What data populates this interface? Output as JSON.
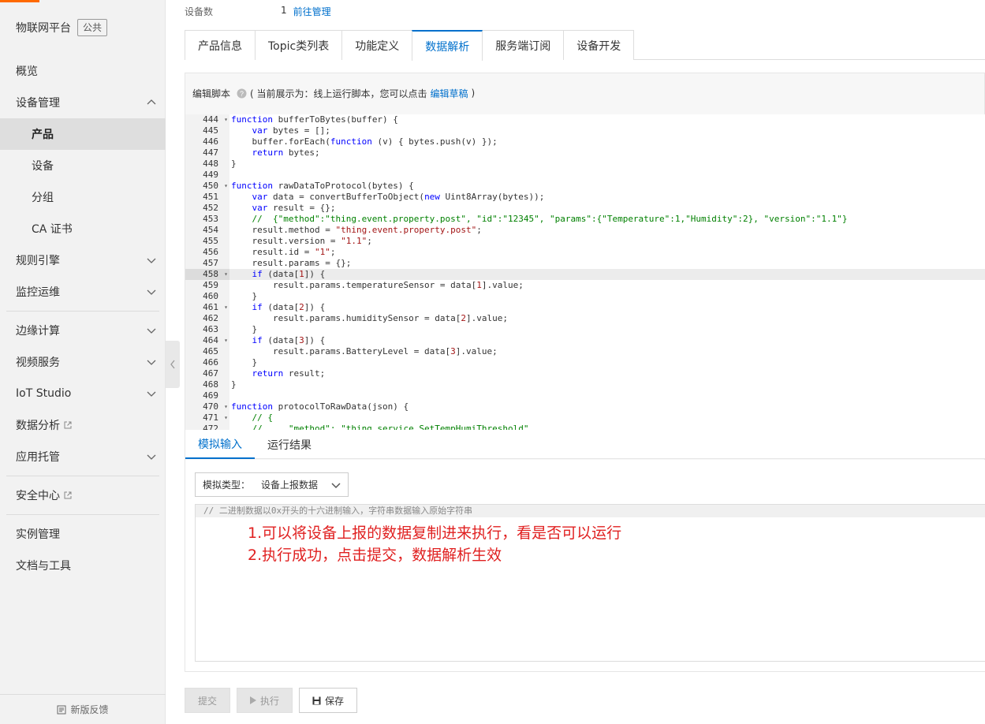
{
  "sidebar": {
    "brand": "物联网平台",
    "badge": "公共",
    "items": [
      {
        "label": "概览"
      },
      {
        "label": "设备管理"
      },
      {
        "label": "产品"
      },
      {
        "label": "设备"
      },
      {
        "label": "分组"
      },
      {
        "label": "CA 证书"
      },
      {
        "label": "规则引擎"
      },
      {
        "label": "监控运维"
      },
      {
        "label": "边缘计算"
      },
      {
        "label": "视频服务"
      },
      {
        "label": "IoT Studio"
      },
      {
        "label": "数据分析"
      },
      {
        "label": "应用托管"
      },
      {
        "label": "安全中心"
      },
      {
        "label": "实例管理"
      },
      {
        "label": "文档与工具"
      }
    ],
    "feedback": "新版反馈"
  },
  "device_row": {
    "label": "设备数",
    "count": "1",
    "link": "前往管理"
  },
  "tabs": [
    "产品信息",
    "Topic类列表",
    "功能定义",
    "数据解析",
    "服务端订阅",
    "设备开发"
  ],
  "editor": {
    "label": "编辑脚本",
    "hint_prefix": "( 当前展示为：线上运行脚本，您可以点击",
    "hint_link": "编辑草稿",
    "hint_suffix": ")"
  },
  "code_lines": [
    {
      "n": "444",
      "fold": true,
      "t": "function bufferToBytes(buffer) {"
    },
    {
      "n": "445",
      "t": "    var bytes = [];"
    },
    {
      "n": "446",
      "t": "    buffer.forEach(function (v) { bytes.push(v) });"
    },
    {
      "n": "447",
      "t": "    return bytes;"
    },
    {
      "n": "448",
      "t": "}"
    },
    {
      "n": "449",
      "t": ""
    },
    {
      "n": "450",
      "fold": true,
      "t": "function rawDataToProtocol(bytes) {"
    },
    {
      "n": "451",
      "t": "    var data = convertBufferToObject(new Uint8Array(bytes));"
    },
    {
      "n": "452",
      "t": "    var result = {};"
    },
    {
      "n": "453",
      "t": "    //  {\"method\":\"thing.event.property.post\", \"id\":\"12345\", \"params\":{\"Temperature\":1,\"Humidity\":2}, \"version\":\"1.1\"}"
    },
    {
      "n": "454",
      "t": "    result.method = \"thing.event.property.post\";"
    },
    {
      "n": "455",
      "t": "    result.version = \"1.1\";"
    },
    {
      "n": "456",
      "t": "    result.id = \"1\";"
    },
    {
      "n": "457",
      "t": "    result.params = {};"
    },
    {
      "n": "458",
      "fold": true,
      "hl": true,
      "t": "    if (data[1]) {"
    },
    {
      "n": "459",
      "t": "        result.params.temperatureSensor = data[1].value;"
    },
    {
      "n": "460",
      "t": "    }"
    },
    {
      "n": "461",
      "fold": true,
      "t": "    if (data[2]) {"
    },
    {
      "n": "462",
      "t": "        result.params.humiditySensor = data[2].value;"
    },
    {
      "n": "463",
      "t": "    }"
    },
    {
      "n": "464",
      "fold": true,
      "t": "    if (data[3]) {"
    },
    {
      "n": "465",
      "t": "        result.params.BatteryLevel = data[3].value;"
    },
    {
      "n": "466",
      "t": "    }"
    },
    {
      "n": "467",
      "t": "    return result;"
    },
    {
      "n": "468",
      "t": "}"
    },
    {
      "n": "469",
      "t": ""
    },
    {
      "n": "470",
      "fold": true,
      "t": "function protocolToRawData(json) {"
    },
    {
      "n": "471",
      "fold": true,
      "t": "    // {"
    },
    {
      "n": "472",
      "t": "    //     \"method\": \"thing.service.SetTempHumiThreshold\","
    }
  ],
  "sim_tabs": [
    "模拟输入",
    "运行结果"
  ],
  "sim": {
    "select_label": "模拟类型：",
    "select_value": "设备上报数据",
    "placeholder": "// 二进制数据以0x开头的十六进制输入，字符串数据输入原始字符串",
    "annotation_1": "1.可以将设备上报的数据复制进来执行，看是否可以运行",
    "annotation_2": "2.执行成功，点击提交，数据解析生效"
  },
  "buttons": {
    "submit": "提交",
    "run": "执行",
    "save": "保存"
  }
}
